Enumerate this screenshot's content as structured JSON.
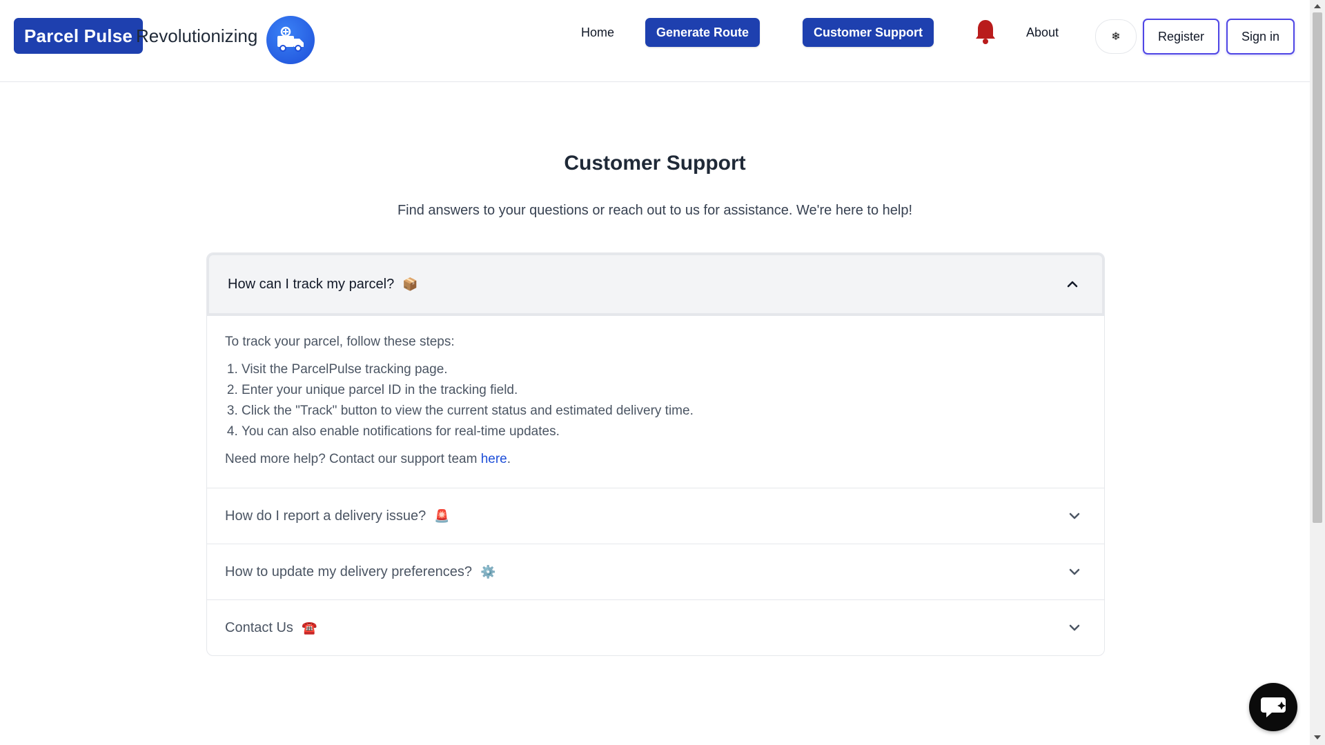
{
  "header": {
    "brand": "Parcel Pulse",
    "tagline": "Revolutionizing",
    "nav": {
      "home": "Home",
      "generate_route": "Generate Route",
      "customer_support": "Customer Support",
      "about": "About"
    },
    "theme_toggle_icon": "❄",
    "register": "Register",
    "sign_in": "Sign in",
    "accent_color": "#1e40af",
    "bell_color": "#b91c1c"
  },
  "main": {
    "title": "Customer Support",
    "subtitle": "Find answers to your questions or reach out to us for assistance. We're here to help!",
    "faq": [
      {
        "question": "How can I track my parcel?",
        "emoji": "📦",
        "expanded": true,
        "answer_intro": "To track your parcel, follow these steps:",
        "steps": [
          "Visit the ParcelPulse tracking page.",
          "Enter your unique parcel ID in the tracking field.",
          "Click the \"Track\" button to view the current status and estimated delivery time.",
          "You can also enable notifications for real-time updates."
        ],
        "help_text": "Need more help? Contact our support team ",
        "help_link": "here",
        "help_suffix": "."
      },
      {
        "question": "How do I report a delivery issue?",
        "emoji": "🚨",
        "expanded": false
      },
      {
        "question": "How to update my delivery preferences?",
        "emoji": "⚙️",
        "expanded": false
      },
      {
        "question": "Contact Us",
        "emoji": "☎️",
        "expanded": false
      }
    ]
  },
  "icons": {
    "logo": "delivery-truck-icon",
    "bell": "bell-icon",
    "chat": "chat-icon",
    "chevron_up": "chevron-up-icon",
    "chevron_down": "chevron-down-icon"
  }
}
